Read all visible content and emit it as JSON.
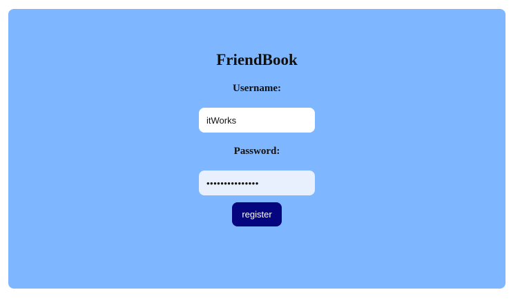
{
  "app": {
    "title": "FriendBook"
  },
  "form": {
    "username_label": "Username:",
    "username_value": "itWorks",
    "password_label": "Password:",
    "password_value": "•••••••••••••••",
    "submit_label": "register"
  },
  "colors": {
    "card_background": "#7eb6ff",
    "button_background": "#050580",
    "password_field_background": "#e8f0fe"
  }
}
